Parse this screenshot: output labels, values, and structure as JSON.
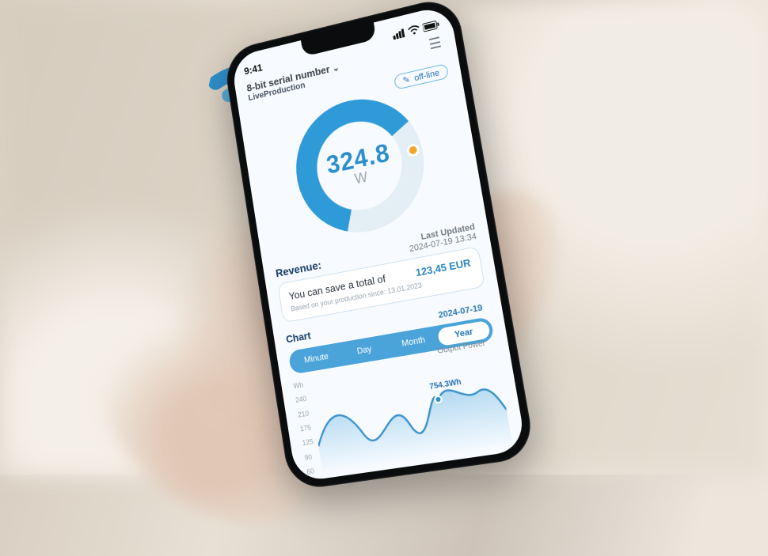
{
  "statusbar": {
    "time": "9:41"
  },
  "header": {
    "serial_label": "8-bit serial number",
    "mode_label": "LiveProduction",
    "offline_label": "off-line"
  },
  "gauge": {
    "value": "324.8",
    "unit": "W"
  },
  "revenue": {
    "title": "Revenue:",
    "updated_title": "Last Updated",
    "updated_value": "2024-07-19 13:34",
    "card_lead": "You can save a total of",
    "card_amount": "123,45 EUR",
    "card_footnote": "Based on your production since: 13.01.2023"
  },
  "chart": {
    "title": "Chart",
    "date": "2024-07-19",
    "tabs": {
      "minute": "Minute",
      "day": "Day",
      "month": "Month",
      "year": "Year"
    },
    "active_tab": "year",
    "series_label": "Output Power",
    "y_unit": "Wh",
    "point_label": "754.3Wh"
  },
  "chart_data": {
    "type": "line",
    "ylabel": "Wh",
    "y_ticks": [
      "240",
      "210",
      "175",
      "125",
      "90",
      "60"
    ],
    "ylim": [
      60,
      240
    ],
    "series": [
      {
        "name": "Output Power",
        "x": [
          0,
          0.12,
          0.25,
          0.38,
          0.5,
          0.62,
          0.74,
          0.86,
          1.0
        ],
        "values": [
          110,
          170,
          120,
          185,
          130,
          190,
          150,
          175,
          140
        ]
      }
    ],
    "annotations": [
      {
        "text": "754.3Wh",
        "x": 0.66,
        "y": 190
      }
    ]
  }
}
